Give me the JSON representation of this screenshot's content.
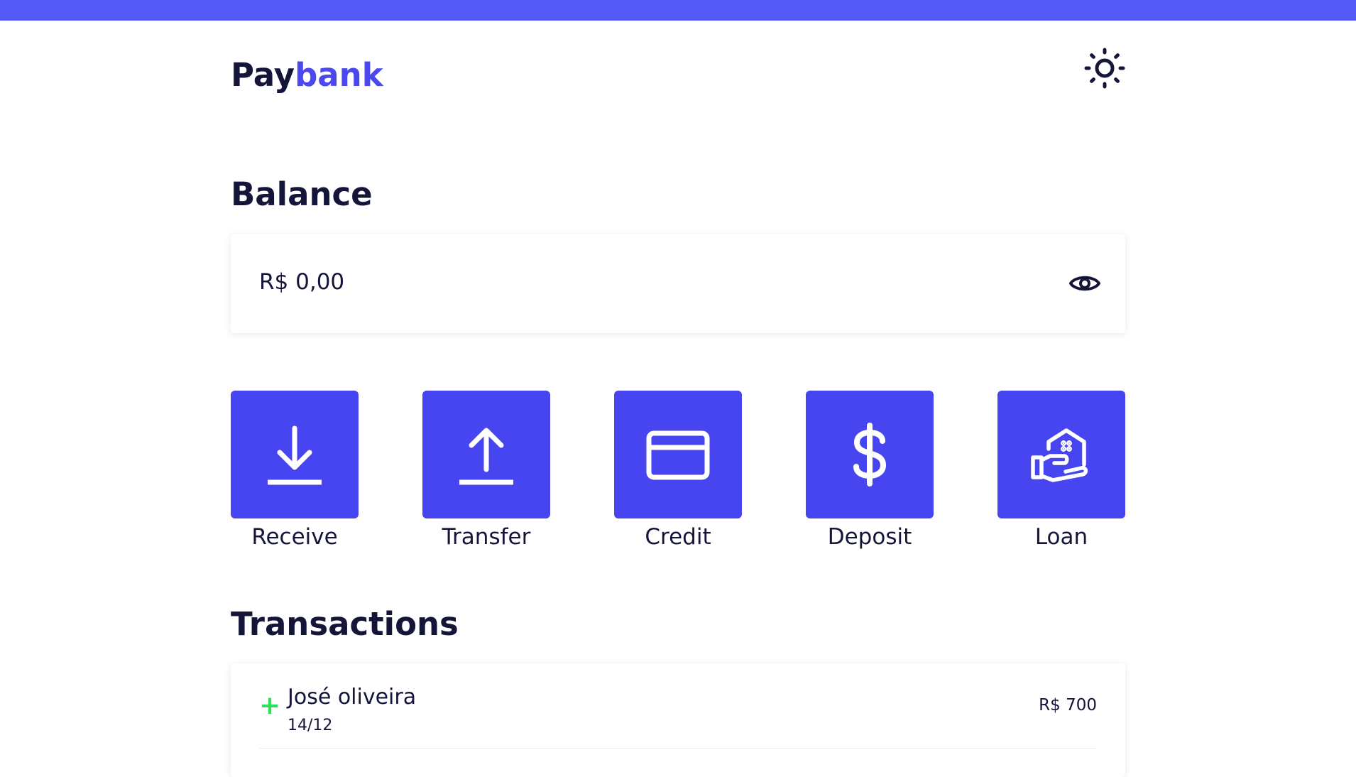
{
  "header": {
    "logo_primary": "Pay",
    "logo_accent": "bank",
    "theme_toggle_icon": "sun-icon"
  },
  "balance": {
    "title": "Balance",
    "amount": "R$ 0,00",
    "visibility_icon": "eye-icon"
  },
  "actions": [
    {
      "label": "Receive",
      "icon": "download-icon"
    },
    {
      "label": "Transfer",
      "icon": "upload-icon"
    },
    {
      "label": "Credit",
      "icon": "credit-card-icon"
    },
    {
      "label": "Deposit",
      "icon": "dollar-icon"
    },
    {
      "label": "Loan",
      "icon": "house-hand-icon"
    }
  ],
  "transactions": {
    "title": "Transactions",
    "items": [
      {
        "sign": "+",
        "name": "José oliveira",
        "date": "14/12",
        "amount": "R$ 700"
      }
    ]
  },
  "colors": {
    "accent": "#4745ef",
    "topbar": "#5459f5",
    "text": "#15153a",
    "positive": "#2ee05a"
  }
}
